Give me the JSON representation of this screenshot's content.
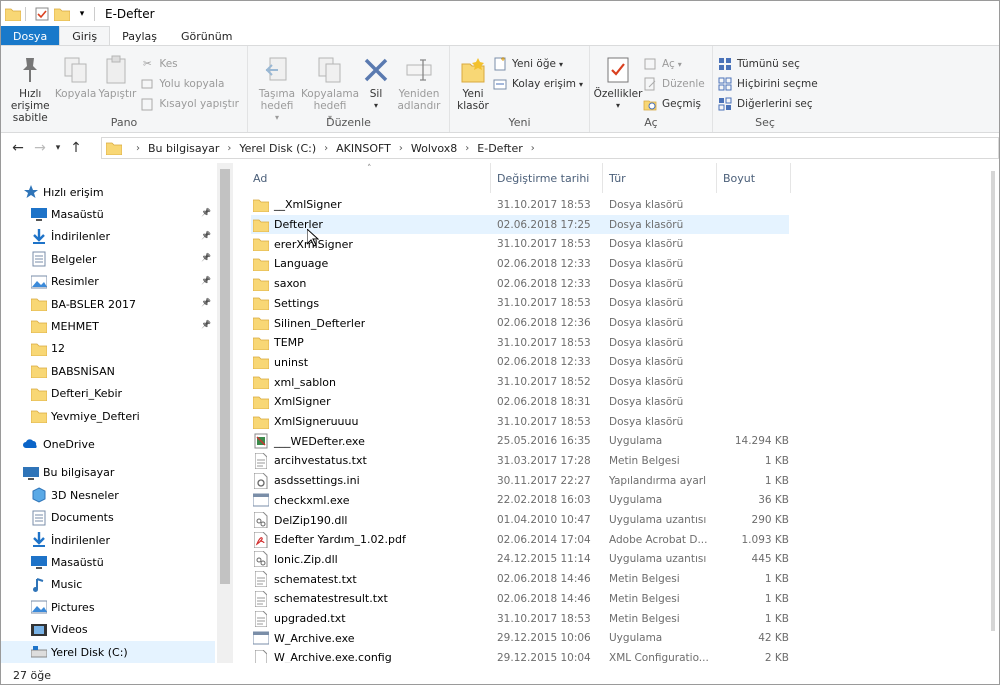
{
  "window": {
    "title": "E-Defter"
  },
  "tabs": [
    {
      "label": "Dosya"
    },
    {
      "label": "Giriş"
    },
    {
      "label": "Paylaş"
    },
    {
      "label": "Görünüm"
    }
  ],
  "ribbon": {
    "pano": {
      "label": "Pano",
      "pin": "Hızlı erişime sabitle",
      "copy": "Kopyala",
      "paste": "Yapıştır",
      "cut": "Kes",
      "copy_path": "Yolu kopyala",
      "paste_shortcut": "Kısayol yapıştır"
    },
    "duzenle": {
      "label": "Düzenle",
      "move": "Taşıma hedefi",
      "copyto": "Kopyalama hedefi",
      "delete": "Sil",
      "rename": "Yeniden adlandır"
    },
    "yeni": {
      "label": "Yeni",
      "new_folder": "Yeni klasör",
      "new_item": "Yeni öğe",
      "easy_access": "Kolay erişim"
    },
    "ac": {
      "label": "Aç",
      "properties": "Özellikler",
      "open": "Aç",
      "edit": "Düzenle",
      "history": "Geçmiş"
    },
    "sec": {
      "label": "Seç",
      "select_all": "Tümünü seç",
      "select_none": "Hiçbirini seçme",
      "invert": "Diğerlerini seç"
    }
  },
  "breadcrumb": [
    "Bu bilgisayar",
    "Yerel Disk (C:)",
    "AKINSOFT",
    "Wolvox8",
    "E-Defter"
  ],
  "navpane": {
    "quick_access": "Hızlı erişim",
    "quick_items": [
      {
        "label": "Masaüstü",
        "icon": "desktop-icon",
        "pinned": true
      },
      {
        "label": "İndirilenler",
        "icon": "download-icon",
        "pinned": true
      },
      {
        "label": "Belgeler",
        "icon": "documents-icon",
        "pinned": true
      },
      {
        "label": "Resimler",
        "icon": "pictures-icon",
        "pinned": true
      },
      {
        "label": "BA-BSLER 2017",
        "icon": "folder-icon",
        "pinned": true
      },
      {
        "label": "MEHMET",
        "icon": "folder-icon",
        "pinned": true
      },
      {
        "label": "12",
        "icon": "folder-icon",
        "pinned": false
      },
      {
        "label": "BABSNİSAN",
        "icon": "folder-icon",
        "pinned": false
      },
      {
        "label": "Defteri_Kebir",
        "icon": "folder-icon",
        "pinned": false
      },
      {
        "label": "Yevmiye_Defteri",
        "icon": "folder-icon",
        "pinned": false
      }
    ],
    "onedrive": "OneDrive",
    "this_pc": "Bu bilgisayar",
    "pc_items": [
      {
        "label": "3D Nesneler",
        "icon": "3d-objects-icon"
      },
      {
        "label": "Documents",
        "icon": "documents-icon"
      },
      {
        "label": "İndirilenler",
        "icon": "download-icon"
      },
      {
        "label": "Masaüstü",
        "icon": "desktop-icon"
      },
      {
        "label": "Music",
        "icon": "music-icon"
      },
      {
        "label": "Pictures",
        "icon": "pictures-icon"
      },
      {
        "label": "Videos",
        "icon": "videos-icon"
      },
      {
        "label": "Yerel Disk (C:)",
        "icon": "drive-icon"
      }
    ]
  },
  "columns": {
    "name": "Ad",
    "date": "Değiştirme tarihi",
    "type": "Tür",
    "size": "Boyut"
  },
  "files": [
    {
      "name": "__XmlSigner",
      "date": "31.10.2017 18:53",
      "type": "Dosya klasörü",
      "size": "",
      "icon": "folder-icon"
    },
    {
      "name": "Defterler",
      "date": "02.06.2018 17:25",
      "type": "Dosya klasörü",
      "size": "",
      "icon": "folder-icon"
    },
    {
      "name": "ererXmlSigner",
      "date": "31.10.2017 18:53",
      "type": "Dosya klasörü",
      "size": "",
      "icon": "folder-icon"
    },
    {
      "name": "Language",
      "date": "02.06.2018 12:33",
      "type": "Dosya klasörü",
      "size": "",
      "icon": "folder-icon"
    },
    {
      "name": "saxon",
      "date": "02.06.2018 12:33",
      "type": "Dosya klasörü",
      "size": "",
      "icon": "folder-icon"
    },
    {
      "name": "Settings",
      "date": "31.10.2017 18:53",
      "type": "Dosya klasörü",
      "size": "",
      "icon": "folder-icon"
    },
    {
      "name": "Silinen_Defterler",
      "date": "02.06.2018 12:36",
      "type": "Dosya klasörü",
      "size": "",
      "icon": "folder-icon"
    },
    {
      "name": "TEMP",
      "date": "31.10.2017 18:53",
      "type": "Dosya klasörü",
      "size": "",
      "icon": "folder-icon"
    },
    {
      "name": "uninst",
      "date": "02.06.2018 12:33",
      "type": "Dosya klasörü",
      "size": "",
      "icon": "folder-icon"
    },
    {
      "name": "xml_sablon",
      "date": "31.10.2017 18:52",
      "type": "Dosya klasörü",
      "size": "",
      "icon": "folder-icon"
    },
    {
      "name": "XmlSigner",
      "date": "02.06.2018 18:31",
      "type": "Dosya klasörü",
      "size": "",
      "icon": "folder-icon"
    },
    {
      "name": "XmlSigneruuuu",
      "date": "31.10.2017 18:53",
      "type": "Dosya klasörü",
      "size": "",
      "icon": "folder-icon"
    },
    {
      "name": "___WEDefter.exe",
      "date": "25.05.2016 16:35",
      "type": "Uygulama",
      "size": "14.294 KB",
      "icon": "app-icon"
    },
    {
      "name": "arcihvestatus.txt",
      "date": "31.03.2017 17:28",
      "type": "Metin Belgesi",
      "size": "1 KB",
      "icon": "text-file-icon"
    },
    {
      "name": "asdssettings.ini",
      "date": "30.11.2017 22:27",
      "type": "Yapılandırma ayarl",
      "size": "1 KB",
      "icon": "settings-file-icon"
    },
    {
      "name": "checkxml.exe",
      "date": "22.02.2018 16:03",
      "type": "Uygulama",
      "size": "36 KB",
      "icon": "exe-icon"
    },
    {
      "name": "DelZip190.dll",
      "date": "01.04.2010 10:47",
      "type": "Uygulama uzantısı",
      "size": "290 KB",
      "icon": "dll-icon"
    },
    {
      "name": "Edefter Yardım_1.02.pdf",
      "date": "02.06.2014 17:04",
      "type": "Adobe Acrobat D...",
      "size": "1.093 KB",
      "icon": "pdf-icon"
    },
    {
      "name": "Ionic.Zip.dll",
      "date": "24.12.2015 11:14",
      "type": "Uygulama uzantısı",
      "size": "445 KB",
      "icon": "dll-icon"
    },
    {
      "name": "schematest.txt",
      "date": "02.06.2018 14:46",
      "type": "Metin Belgesi",
      "size": "1 KB",
      "icon": "text-file-icon"
    },
    {
      "name": "schematestresult.txt",
      "date": "02.06.2018 14:46",
      "type": "Metin Belgesi",
      "size": "1 KB",
      "icon": "text-file-icon"
    },
    {
      "name": "upgraded.txt",
      "date": "31.10.2017 18:53",
      "type": "Metin Belgesi",
      "size": "1 KB",
      "icon": "text-file-icon"
    },
    {
      "name": "W_Archive.exe",
      "date": "29.12.2015 10:06",
      "type": "Uygulama",
      "size": "42 KB",
      "icon": "exe-icon"
    },
    {
      "name": "W_Archive.exe.config",
      "date": "29.12.2015 10:04",
      "type": "XML Configuratio...",
      "size": "2 KB",
      "icon": "config-file-icon"
    }
  ],
  "status": {
    "count": "27 öğe"
  },
  "colors": {
    "accent": "#1979ca",
    "folder": "#f8d775",
    "hover": "#e5f3ff"
  }
}
